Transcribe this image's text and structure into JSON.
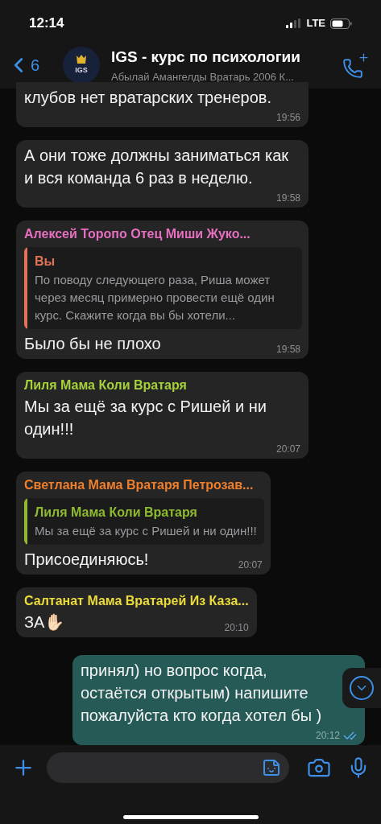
{
  "status_bar": {
    "time": "12:14",
    "network": "LTE"
  },
  "header": {
    "back_count": "6",
    "avatar_text": "IGS",
    "title": "IGS - курс по психологии",
    "subtitle": "Абылай Амангелды Вратарь 2006 К..."
  },
  "messages": [
    {
      "kind": "incoming",
      "cut_top": true,
      "text": "клубов нет вратарских тренеров.",
      "time": "19:56"
    },
    {
      "kind": "incoming",
      "text": "А они тоже должны заниматься как и вся команда 6 раз в неделю.",
      "time": "19:58"
    },
    {
      "kind": "incoming",
      "sender": {
        "name": "Алексей Торопо Отец Миши Жуко...",
        "color": "#e76fc0"
      },
      "quote": {
        "author": "Вы",
        "color": "#e2735a",
        "text": "По поводу следующего раза, Риша может через месяц примерно провести ещё один курс. Скажите когда вы бы хотели..."
      },
      "text": "Было бы не плохо",
      "time": "19:58"
    },
    {
      "kind": "incoming",
      "sender": {
        "name": "Лиля Мама Коли Вратаря",
        "color": "#a6d13a"
      },
      "text": "Мы за ещё за курс с Ришей и ни один!!!",
      "time": "20:07"
    },
    {
      "kind": "incoming",
      "sender": {
        "name": "Светлана Мама Вратаря Петрозав...",
        "color": "#f07f2c"
      },
      "quote": {
        "author": "Лиля Мама Коли Вратаря",
        "color": "#8fba2f",
        "text": "Мы за ещё за курс с Ришей и ни один!!!"
      },
      "text": "Присоединяюсь!",
      "time": "20:07"
    },
    {
      "kind": "incoming",
      "sender": {
        "name": "Салтанат Мама Вратарей Из Каза...",
        "color": "#ecdc3a"
      },
      "text": "ЗА✋🏻",
      "time": "20:10"
    },
    {
      "kind": "outgoing",
      "text": "принял) но вопрос когда, остаётся открытым) напишите пожалуйста кто когда хотел бы )",
      "time": "20:12",
      "read": true
    }
  ]
}
